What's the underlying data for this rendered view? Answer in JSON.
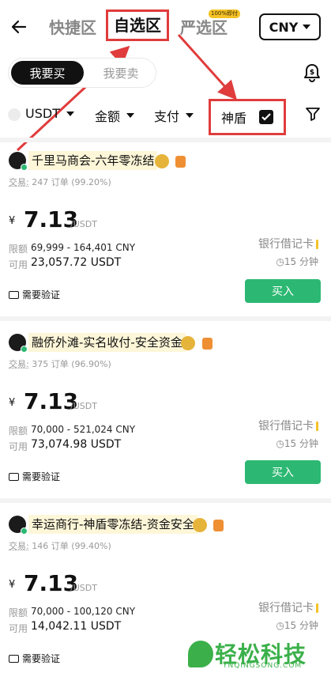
{
  "header": {
    "tabs": [
      {
        "label": "快捷区"
      },
      {
        "label": "自选区"
      },
      {
        "label": "严选区",
        "badge": "100%即付"
      }
    ],
    "currency": "CNY"
  },
  "switch": {
    "buy": "我要买",
    "sell": "我要卖"
  },
  "filters": {
    "coin": "USDT",
    "amount": "金额",
    "payment": "支付",
    "shield": "神盾"
  },
  "common": {
    "orders_label": "交易:",
    "orders_unit": "订单",
    "yen": "¥",
    "per_unit": "/USDT",
    "limit_label": "限额",
    "avail_label": "可用",
    "payment_method": "银行借记卡",
    "time": "15 分钟",
    "buy_button": "买入",
    "verify": "需要验证"
  },
  "listings": [
    {
      "name": "千里马商会-六年零冻结",
      "orders": "247",
      "rate": "(99.20%)",
      "price": "7.13",
      "limit": "69,999 - 164,401 CNY",
      "available": "23,057.72 USDT"
    },
    {
      "name": "融侨外滩-实名收付-安全资金",
      "orders": "375",
      "rate": "(96.90%)",
      "price": "7.13",
      "limit": "70,000 - 521,024 CNY",
      "available": "73,074.98 USDT"
    },
    {
      "name": "幸运商行-神盾零冻结-资金安全",
      "orders": "146",
      "rate": "(99.40%)",
      "price": "7.13",
      "limit": "70,000 - 100,120 CNY",
      "available": "14,042.11 USDT"
    }
  ],
  "watermark": {
    "title": "轻松科技",
    "sub": "YNQINGSONG.COM"
  },
  "colors": {
    "accent_green": "#2cb872",
    "highlight_red": "#e03c3c"
  }
}
